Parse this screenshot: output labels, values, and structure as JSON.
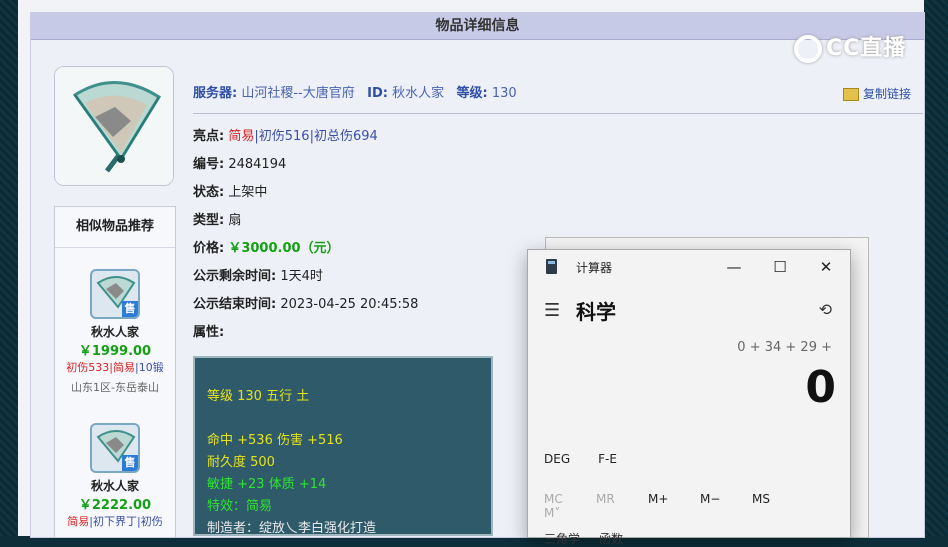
{
  "header": {
    "title": "物品详细信息"
  },
  "watermark": {
    "text": "CC直播"
  },
  "summary": {
    "server_label": "服务器:",
    "server_value": "山河社稷--大唐官府",
    "id_label": "ID:",
    "id_value": "秋水人家",
    "level_label": "等级:",
    "level_value": "130",
    "copy_link": "复制链接"
  },
  "fields": {
    "highlight_label": "亮点:",
    "highlight_1": "简易",
    "highlight_2": "|初伤516",
    "highlight_3": "|初总伤694",
    "number_label": "编号:",
    "number_value": "2484194",
    "status_label": "状态:",
    "status_value": "上架中",
    "type_label": "类型:",
    "type_value": "扇",
    "price_label": "价格:",
    "price_value": "￥3000.00（元）",
    "remain_label": "公示剩余时间:",
    "remain_value": "1天4时",
    "end_label": "公示结束时间:",
    "end_value": "2023-04-25 20:45:58",
    "attr_label": "属性:"
  },
  "attributes": [
    "等级 130 五行 土",
    "命中 +536 伤害 +516",
    "耐久度 500",
    "敏捷 +23 体质 +14",
    "特效：简易",
    "制造者：绽放乀李白强化打造"
  ],
  "similar": {
    "title": "相似物品推荐",
    "sale_tag": "售",
    "items": [
      {
        "name": "秋水人家",
        "price": "￥1999.00",
        "tag_a": "初伤533",
        "tag_b": "|简易",
        "tag_c": "|10锻",
        "server": "山东1区-东岳泰山"
      },
      {
        "name": "秋水人家",
        "price": "￥2222.00",
        "tag_a": "简易",
        "tag_b": "|初下界丁",
        "tag_c": "|初伤",
        "server": ""
      }
    ]
  },
  "calculator": {
    "title": "计算器",
    "mode": "科学",
    "expression": "0 + 34 + 29 +",
    "result": "0",
    "deg": "DEG",
    "fe": "F-E",
    "memory": [
      "MC",
      "MR",
      "M+",
      "M−",
      "MS",
      "M˅"
    ],
    "bottom_1": "三角学",
    "bottom_2": "函数",
    "minimize": "—",
    "maximize": "☐",
    "close": "✕"
  },
  "colors": {
    "accent_green": "#13a013",
    "accent_red": "#d22222",
    "attr_bg": "#2e5a69"
  }
}
